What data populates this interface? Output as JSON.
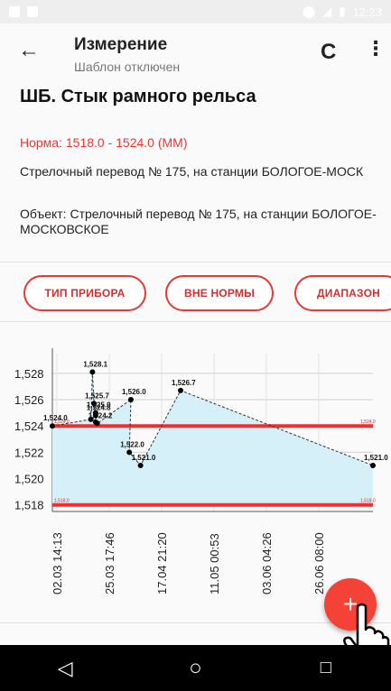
{
  "status_bar": {
    "time": "12:23"
  },
  "appbar": {
    "title": "Измерение",
    "subtitle": "Шаблон отключен",
    "back_icon": "arrow-left-icon",
    "refresh_icon": "refresh-icon",
    "more_icon": "more-vert-icon"
  },
  "content": {
    "heading": "ШБ. Стык рамного рельса",
    "norm": "Норма: 1518.0 - 1524.0 (ММ)",
    "switch_info": "Стрелочный перевод № 175, на станции БОЛОГОЕ-МОСК",
    "object_info": "Объект: Стрелочный перевод № 175, на станции БОЛОГОЕ-МОСКОВСКОЕ"
  },
  "chips": [
    "ТИП ПРИБОРА",
    "ВНЕ НОРМЫ",
    "ДИАПАЗОН"
  ],
  "colors": {
    "accent": "#e53935",
    "fill": "#d6f0fa",
    "fab": "#f44336"
  },
  "chart_data": {
    "type": "line",
    "ylim": [
      1517.5,
      1529.5
    ],
    "yticks": [
      "1,528",
      "1,526",
      "1,524",
      "1,522",
      "1,520",
      "1,518"
    ],
    "ytick_values": [
      1528,
      1526,
      1524,
      1522,
      1520,
      1518
    ],
    "xtick_labels": [
      "02.03  14:13",
      "25.03  17:46",
      "17.04  21:20",
      "11.05  00:53",
      "03.06  04:26",
      "26.06  08:00"
    ],
    "limits": {
      "upper": 1524.0,
      "lower": 1518.0,
      "upper_label": "1,524.0",
      "lower_label": "1,518.0"
    },
    "points": [
      {
        "t": 0.0,
        "y": 1524.0,
        "label": "1,524.0"
      },
      {
        "t": 0.12,
        "y": 1524.5,
        "label": ""
      },
      {
        "t": 0.125,
        "y": 1528.1,
        "label": "1,528.1"
      },
      {
        "t": 0.13,
        "y": 1525.7,
        "label": "1,525.7"
      },
      {
        "t": 0.135,
        "y": 1524.3,
        "label": ""
      },
      {
        "t": 0.135,
        "y": 1525.0,
        "label": "1,525.0"
      },
      {
        "t": 0.135,
        "y": 1524.8,
        "label": "1,524.8"
      },
      {
        "t": 0.14,
        "y": 1524.2,
        "label": "1,524.2"
      },
      {
        "t": 0.245,
        "y": 1526.0,
        "label": "1,526.0"
      },
      {
        "t": 0.24,
        "y": 1522.0,
        "label": "1,522.0"
      },
      {
        "t": 0.275,
        "y": 1521.0,
        "label": "1,521.0"
      },
      {
        "t": 0.4,
        "y": 1526.7,
        "label": "1,526.7"
      },
      {
        "t": 1.0,
        "y": 1521.0,
        "label": "1,521.0"
      }
    ]
  },
  "fab": {
    "label": "+"
  },
  "nav": {
    "back": "◁",
    "home": "○",
    "recents": "□"
  }
}
